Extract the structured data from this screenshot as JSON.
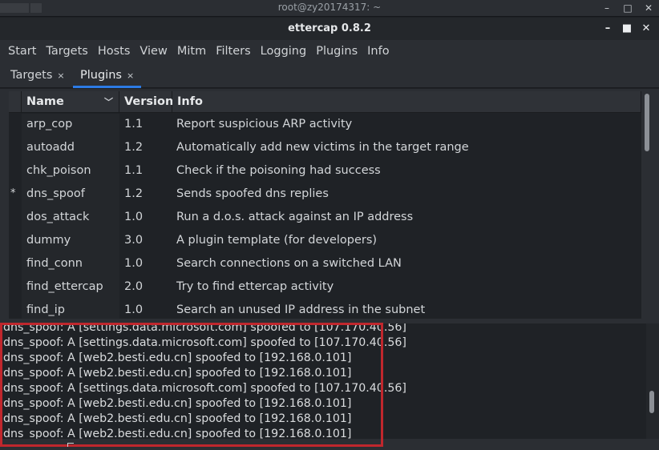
{
  "terminal": {
    "title": "root@zy20174317: ~",
    "controls": [
      "–",
      "□",
      "✕"
    ]
  },
  "window": {
    "title": "ettercap 0.8.2",
    "controls": [
      "–",
      "■",
      "✕"
    ]
  },
  "menu": [
    "Start",
    "Targets",
    "Hosts",
    "View",
    "Mitm",
    "Filters",
    "Logging",
    "Plugins",
    "Info"
  ],
  "tabs": [
    {
      "label": "Targets",
      "close": "×",
      "active": false
    },
    {
      "label": "Plugins",
      "close": "×",
      "active": true
    }
  ],
  "table": {
    "columns": {
      "name": "Name",
      "version": "Version",
      "info": "Info",
      "sort_icon": "chevron-down-icon"
    },
    "rows": [
      {
        "mark": "",
        "name": "arp_cop",
        "version": "1.1",
        "info": "Report suspicious ARP activity"
      },
      {
        "mark": "",
        "name": "autoadd",
        "version": "1.2",
        "info": "Automatically add new victims in the target range"
      },
      {
        "mark": "",
        "name": "chk_poison",
        "version": "1.1",
        "info": "Check if the poisoning had success"
      },
      {
        "mark": "*",
        "name": "dns_spoof",
        "version": "1.2",
        "info": "Sends spoofed dns replies"
      },
      {
        "mark": "",
        "name": "dos_attack",
        "version": "1.0",
        "info": "Run a d.o.s. attack against an IP address"
      },
      {
        "mark": "",
        "name": "dummy",
        "version": "3.0",
        "info": "A plugin template (for developers)"
      },
      {
        "mark": "",
        "name": "find_conn",
        "version": "1.0",
        "info": "Search connections on a switched LAN"
      },
      {
        "mark": "",
        "name": "find_ettercap",
        "version": "2.0",
        "info": "Try to find ettercap activity"
      },
      {
        "mark": "",
        "name": "find_ip",
        "version": "1.0",
        "info": "Search an unused IP address in the subnet"
      }
    ]
  },
  "log": [
    "dns_spoof: A [settings.data.microsoft.com] spoofed to [107.170.40.56]",
    "dns_spoof: A [settings.data.microsoft.com] spoofed to [107.170.40.56]",
    "dns_spoof: A [web2.besti.edu.cn] spoofed to [192.168.0.101]",
    "dns_spoof: A [web2.besti.edu.cn] spoofed to [192.168.0.101]",
    "dns_spoof: A [settings.data.microsoft.com] spoofed to [107.170.40.56]",
    "dns_spoof: A [web2.besti.edu.cn] spoofed to [192.168.0.101]",
    "dns_spoof: A [web2.besti.edu.cn] spoofed to [192.168.0.101]",
    "dns_spoof: A [web2.besti.edu.cn] spoofed to [192.168.0.101]"
  ],
  "colors": {
    "accent": "#2c7be5",
    "highlight": "#c0272d"
  }
}
